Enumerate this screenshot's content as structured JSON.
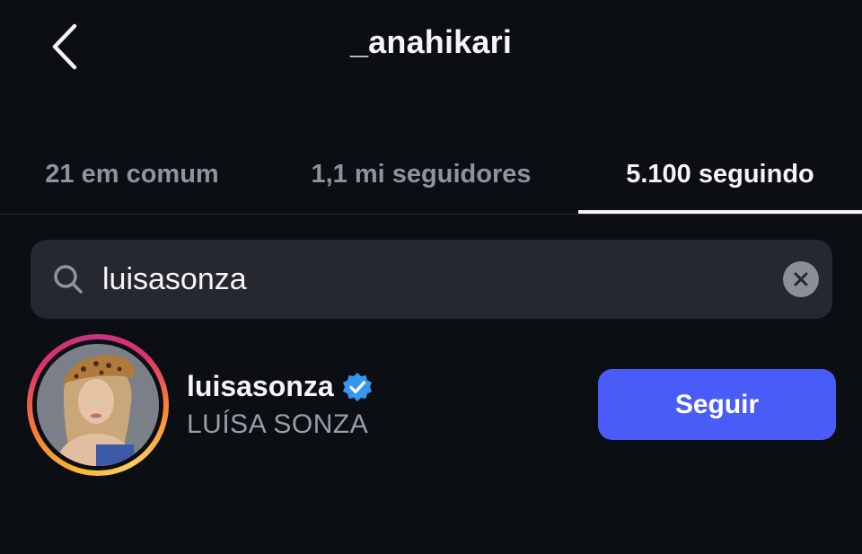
{
  "header": {
    "title": "_anahikari",
    "back_icon": "chevron-left-icon"
  },
  "tabs": [
    {
      "label": "21 em comum",
      "active": false
    },
    {
      "label": "1,1 mi seguidores",
      "active": false
    },
    {
      "label": "5.100 seguindo",
      "active": true
    }
  ],
  "search": {
    "value": "luisasonza",
    "icon": "search-icon",
    "clear_icon": "clear-icon"
  },
  "results": [
    {
      "username": "luisasonza",
      "full_name": "LUÍSA SONZA",
      "verified": true,
      "has_story_ring": true,
      "button_label": "Seguir"
    }
  ],
  "colors": {
    "background": "#0b0e13",
    "search_bg": "#25282e",
    "follow_button": "#4a5cf7",
    "verified_badge": "#3797f0",
    "muted_text": "#8f949c"
  }
}
